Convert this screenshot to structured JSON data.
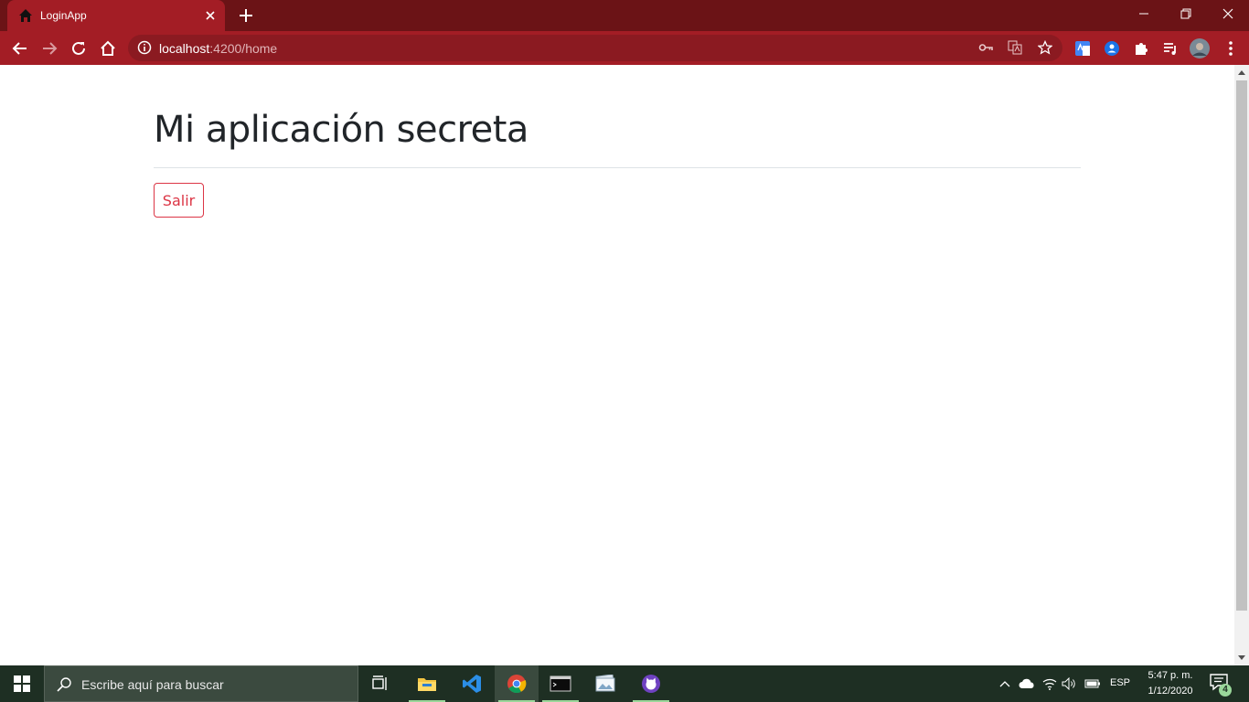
{
  "browser": {
    "tab": {
      "title": "LoginApp",
      "favicon": "home-icon"
    },
    "url": {
      "host": "localhost",
      "rest": ":4200/home"
    }
  },
  "page": {
    "title": "Mi aplicación secreta",
    "logout_button": "Salir"
  },
  "taskbar": {
    "search_placeholder": "Escribe aquí para buscar",
    "language": "ESP",
    "time": "5:47 p. m.",
    "date": "1/12/2020",
    "notifications_count": "4"
  },
  "colors": {
    "tabstrip": "#6b1316",
    "toolbar": "#a31d25",
    "danger": "#dc3545",
    "taskbar": "#1e2f23"
  }
}
